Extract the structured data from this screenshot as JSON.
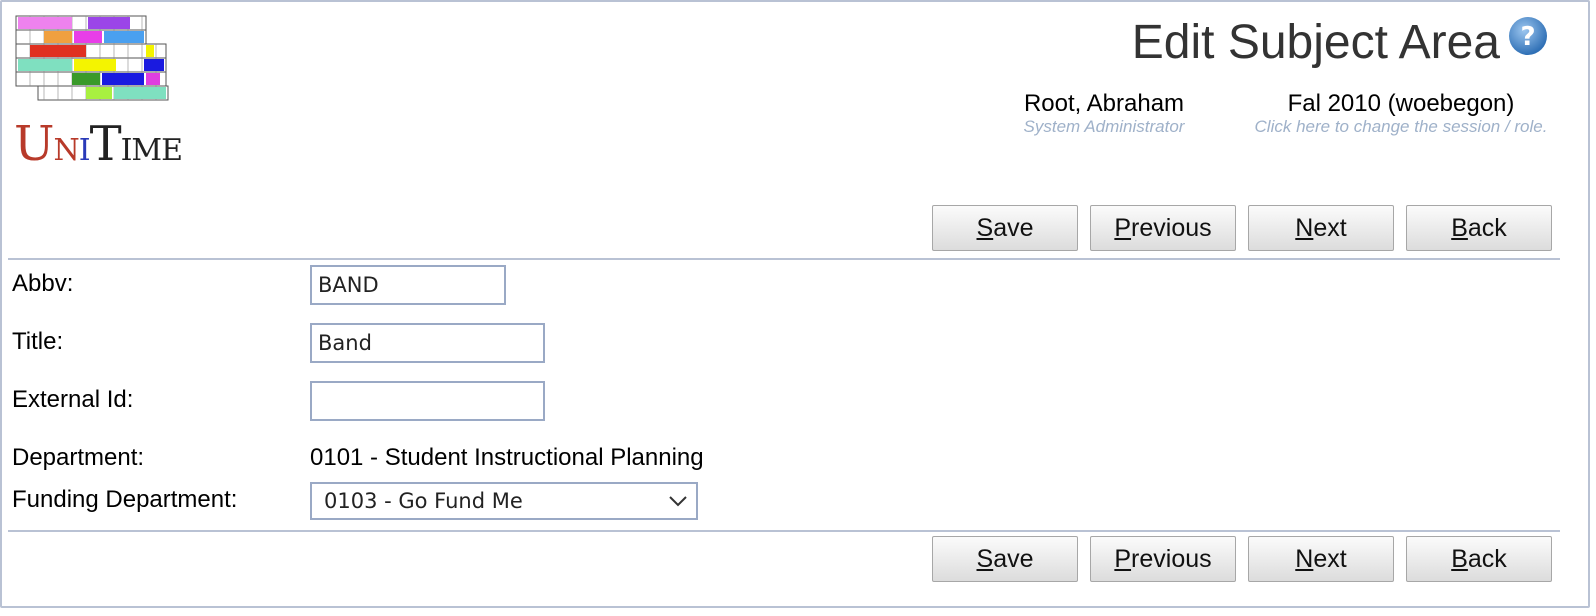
{
  "app": {
    "logo_alt": "UniTime"
  },
  "header": {
    "title": "Edit Subject Area",
    "user": {
      "name": "Root, Abraham",
      "role": "System Administrator"
    },
    "session": {
      "name": "Fal 2010 (woebegon)",
      "hint": "Click here to change the session / role."
    }
  },
  "buttons": {
    "save": {
      "key": "S",
      "rest": "ave"
    },
    "previous": {
      "key": "P",
      "rest": "revious"
    },
    "next": {
      "key": "N",
      "rest": "ext"
    },
    "back": {
      "key": "B",
      "rest": "ack"
    }
  },
  "form": {
    "abbv": {
      "label": "Abbv:",
      "value": "BAND"
    },
    "title": {
      "label": "Title:",
      "value": "Band"
    },
    "external_id": {
      "label": "External Id:",
      "value": ""
    },
    "department": {
      "label": "Department:",
      "value": "0101 - Student Instructional Planning"
    },
    "funding_department": {
      "label": "Funding Department:",
      "value": "0103 - Go Fund Me"
    }
  },
  "colors": {
    "accent": "#4a90d9",
    "border": "#b9c2d4",
    "hint": "#9fb1c9"
  },
  "icons": {
    "help": "help-icon",
    "dropdown": "chevron-down-icon"
  }
}
